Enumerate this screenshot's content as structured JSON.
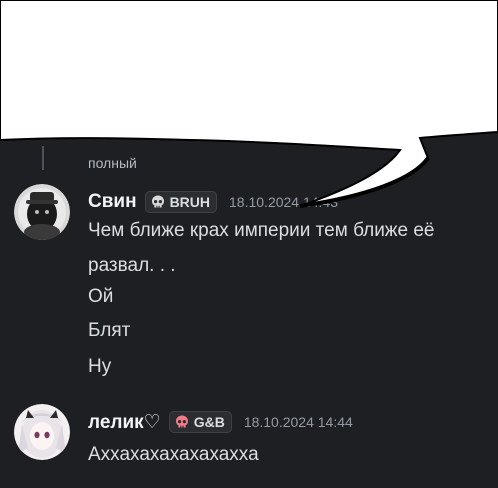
{
  "previous_message": {
    "fragment": "полный"
  },
  "messages": [
    {
      "username": "Свин",
      "tag": {
        "icon": "skull-icon",
        "label": "BRUH",
        "icon_color": "#d9d9d9"
      },
      "timestamp": "18.10.2024 14:43",
      "lines": [
        "Чем ближе крах империи тем ближе её",
        "развал. . .",
        "Ой",
        "Блят",
        "Ну"
      ]
    },
    {
      "username": "лелик♡",
      "tag": {
        "icon": "skull-icon",
        "label": "G&B",
        "icon_color": "#f47b8a"
      },
      "timestamp": "18.10.2024 14:44",
      "lines": [
        "Аххахахахахахахха"
      ]
    }
  ],
  "colors": {
    "background": "#1e1f22",
    "text": "#dbdee1",
    "username": "#f2f3f5",
    "timestamp": "#949ba4",
    "bubble": "#ffffff"
  }
}
